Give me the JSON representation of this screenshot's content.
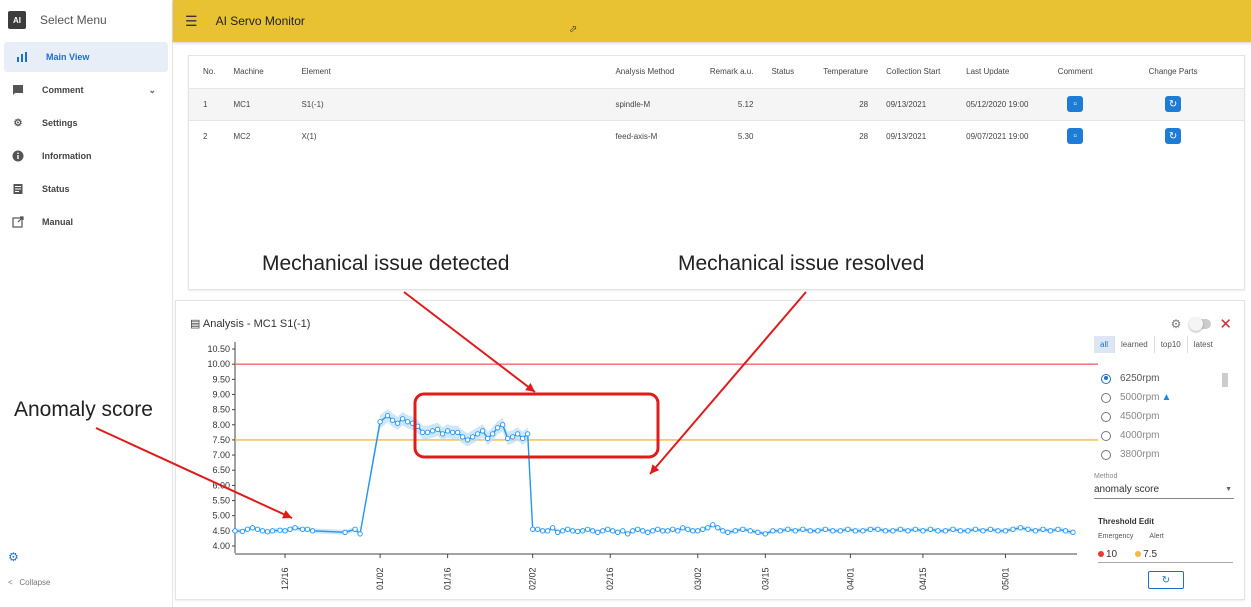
{
  "sidebar": {
    "logo_text": "AI",
    "title": "Select Menu",
    "items": [
      {
        "label": "Main View",
        "icon": "bar-chart-icon"
      },
      {
        "label": "Comment",
        "icon": "comment-icon"
      },
      {
        "label": "Settings",
        "icon": "gear-icon"
      },
      {
        "label": "Information",
        "icon": "info-icon"
      },
      {
        "label": "Status",
        "icon": "document-icon"
      },
      {
        "label": "Manual",
        "icon": "external-link-icon"
      }
    ],
    "collapse_label": "Collapse"
  },
  "topbar": {
    "title": "AI Servo Monitor",
    "color": "#e8c232"
  },
  "table": {
    "headers": [
      "No.",
      "Machine",
      "Element",
      "Analysis Method",
      "Remark a.u.",
      "Status",
      "Temperature",
      "Collection Start",
      "Last Update",
      "Comment",
      "Change Parts"
    ],
    "rows": [
      {
        "no": "1",
        "machine": "MC1",
        "element": "S1(-1)",
        "method": "spindle-M",
        "remark": "5.12",
        "status": "",
        "temperature": "28",
        "start": "09/13/2021",
        "update": "05/12/2020 19:00"
      },
      {
        "no": "2",
        "machine": "MC2",
        "element": "X(1)",
        "method": "feed-axis-M",
        "remark": "5.30",
        "status": "",
        "temperature": "28",
        "start": "09/13/2021",
        "update": "09/07/2021 19:00"
      }
    ]
  },
  "annotations": {
    "detected": "Mechanical issue detected",
    "resolved": "Mechanical issue resolved",
    "anomaly": "Anomaly score"
  },
  "analysis": {
    "title": "Analysis - MC1 S1(-1)",
    "tabs": [
      "all",
      "learned",
      "top10",
      "latest"
    ],
    "active_tab": "all",
    "rpm_options": [
      "6250rpm",
      "5000rpm",
      "4500rpm",
      "4000rpm",
      "3800rpm"
    ],
    "selected_rpm": "6250rpm",
    "method_label": "Method",
    "method_value": "anomaly score",
    "threshold_title": "Threshold Edit",
    "emergency_label": "Emergency",
    "alert_label": "Alert",
    "emergency_value": "10",
    "alert_value": "7.5",
    "emergency_color": "#e53935",
    "alert_color": "#f6b93b"
  },
  "chart_data": {
    "type": "line",
    "y_ticks": [
      "4.00",
      "4.50",
      "5.00",
      "5.50",
      "6.00",
      "6.50",
      "7.00",
      "7.50",
      "8.00",
      "8.50",
      "9.00",
      "9.50",
      "10.00",
      "10.50"
    ],
    "ylim": [
      3.9,
      10.6
    ],
    "x_ticks": [
      "12/16",
      "01/02",
      "01/16",
      "02/02",
      "02/16",
      "03/02",
      "03/15",
      "04/01",
      "04/15",
      "05/01"
    ],
    "thresholds": {
      "emergency": 10,
      "alert": 7.5
    },
    "series": [
      {
        "color": "#2196f3",
        "x": [
          0,
          3,
          5,
          7,
          9,
          11,
          13,
          15,
          18,
          20,
          22,
          24,
          27,
          29,
          31,
          44,
          48,
          50,
          58,
          61,
          63,
          65,
          67,
          69,
          71,
          73,
          75,
          77,
          79,
          81,
          83,
          85,
          87,
          89,
          91,
          93,
          95,
          97,
          99,
          101,
          103,
          105,
          107,
          109,
          111,
          113,
          115,
          117,
          119,
          121,
          123,
          125,
          127,
          129,
          131,
          133,
          135,
          137,
          139,
          141,
          143,
          145,
          147,
          149,
          151,
          153,
          155,
          157,
          159,
          161,
          163,
          165,
          167,
          169,
          171,
          173,
          175,
          177,
          179,
          181,
          183,
          185,
          187,
          189,
          191,
          193,
          195,
          197,
          200,
          203,
          206,
          209,
          212,
          215,
          218,
          221,
          224,
          227,
          230,
          233,
          236,
          239,
          242,
          245,
          248,
          251,
          254,
          257,
          260,
          263,
          266,
          269,
          272,
          275,
          278,
          281,
          284,
          287,
          290,
          293,
          296,
          299,
          302,
          305,
          308,
          311,
          314,
          317,
          320,
          323,
          326,
          329,
          332,
          335
        ],
        "values": [
          4.5,
          4.48,
          4.55,
          4.6,
          4.55,
          4.5,
          4.47,
          4.5,
          4.52,
          4.5,
          4.55,
          4.6,
          4.55,
          4.55,
          4.5,
          4.45,
          4.55,
          4.4,
          8.1,
          8.3,
          8.15,
          8.05,
          8.2,
          8.1,
          8.05,
          7.95,
          7.75,
          7.75,
          7.8,
          7.85,
          7.7,
          7.8,
          7.75,
          7.75,
          7.6,
          7.5,
          7.6,
          7.7,
          7.8,
          7.55,
          7.7,
          7.9,
          8.0,
          7.55,
          7.6,
          7.7,
          7.55,
          7.7,
          4.55,
          4.55,
          4.5,
          4.5,
          4.6,
          4.45,
          4.5,
          4.55,
          4.5,
          4.48,
          4.5,
          4.55,
          4.5,
          4.45,
          4.5,
          4.55,
          4.5,
          4.45,
          4.5,
          4.4,
          4.5,
          4.55,
          4.5,
          4.45,
          4.5,
          4.55,
          4.5,
          4.5,
          4.55,
          4.5,
          4.6,
          4.55,
          4.5,
          4.5,
          4.55,
          4.6,
          4.7,
          4.6,
          4.5,
          4.45,
          4.5,
          4.55,
          4.5,
          4.45,
          4.4,
          4.5,
          4.5,
          4.55,
          4.5,
          4.55,
          4.5,
          4.5,
          4.55,
          4.5,
          4.5,
          4.55,
          4.5,
          4.5,
          4.55,
          4.55,
          4.5,
          4.5,
          4.55,
          4.5,
          4.55,
          4.5,
          4.55,
          4.5,
          4.5,
          4.55,
          4.5,
          4.5,
          4.55,
          4.5,
          4.55,
          4.5,
          4.5,
          4.55,
          4.6,
          4.55,
          4.5,
          4.55,
          4.5,
          4.55,
          4.5,
          4.45
        ]
      }
    ]
  }
}
